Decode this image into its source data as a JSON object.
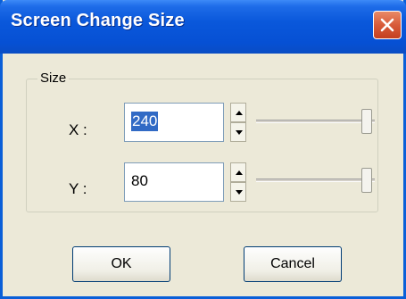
{
  "window": {
    "title": "Screen Change Size"
  },
  "group": {
    "label": "Size"
  },
  "x_row": {
    "label": "X :",
    "value": "240",
    "slider_fraction": 1.0
  },
  "y_row": {
    "label": "Y :",
    "value": "80",
    "slider_fraction": 1.0
  },
  "buttons": {
    "ok": "OK",
    "cancel": "Cancel"
  },
  "colors": {
    "titlebar": "#0a58db",
    "selection": "#316ac5",
    "close": "#d85b3a",
    "dialog_bg": "#ece9d8"
  },
  "icons": {
    "close": "close-icon",
    "spin_up": "spin-up-arrow-icon",
    "spin_down": "spin-down-arrow-icon"
  }
}
